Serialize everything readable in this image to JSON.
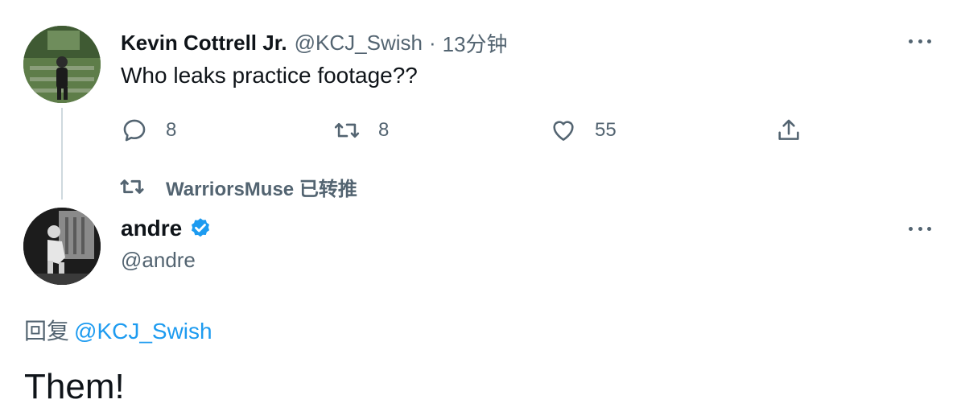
{
  "parent_tweet": {
    "author": {
      "display_name": "Kevin Cottrell Jr.",
      "handle": "@KCJ_Swish",
      "avatar": "avatar"
    },
    "separator": "·",
    "time": "13分钟",
    "text": "Who leaks practice footage??",
    "actions": {
      "reply_count": "8",
      "retweet_count": "8",
      "like_count": "55"
    },
    "icons": [
      "reply-icon",
      "retweet-icon",
      "like-icon",
      "share-icon",
      "more-icon"
    ]
  },
  "retweeted_by": {
    "label": "WarriorsMuse 已转推",
    "icon": "retweet-icon"
  },
  "tweet": {
    "author": {
      "display_name": "andre",
      "handle": "@andre",
      "verified": true,
      "avatar": "avatar"
    },
    "reply_prefix": "回复",
    "reply_mention": "@KCJ_Swish",
    "text": "Them!"
  },
  "colors": {
    "text_primary": "#0f1419",
    "text_secondary": "#536471",
    "accent": "#1d9bf0",
    "thread_line": "#cfd9de"
  }
}
